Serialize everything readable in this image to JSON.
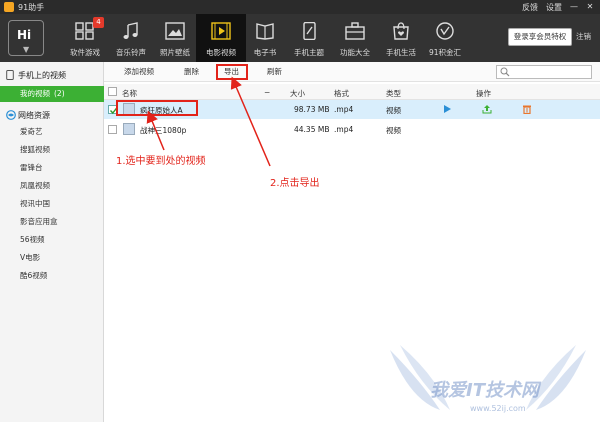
{
  "app": {
    "title": "91助手"
  },
  "titlebar": {
    "links": [
      "反馈",
      "设置"
    ],
    "minimize": "—",
    "close": "✕"
  },
  "topnav": {
    "hi_label": "Hi",
    "hi_arrow": "▼",
    "items": [
      {
        "label": "软件游戏",
        "icon": "apps-grid-icon",
        "badge": "4"
      },
      {
        "label": "音乐铃声",
        "icon": "music-note-icon"
      },
      {
        "label": "照片壁纸",
        "icon": "photo-icon"
      },
      {
        "label": "电影视频",
        "icon": "film-icon",
        "active": true
      },
      {
        "label": "电子书",
        "icon": "book-icon"
      },
      {
        "label": "手机主题",
        "icon": "phone-theme-icon"
      },
      {
        "label": "功能大全",
        "icon": "toolbox-icon"
      },
      {
        "label": "手机生活",
        "icon": "shopping-bag-icon"
      },
      {
        "label": "91积金汇",
        "icon": "coin-icon"
      }
    ],
    "vip_button": "登录享会员特权",
    "logout": "注销"
  },
  "sidebar": {
    "phone_section": "手机上的视频",
    "my_video": {
      "label": "我的视频",
      "count": "(2)"
    },
    "net_section": "网络资源",
    "net_items": [
      "爱奇艺",
      "搜狐视频",
      "雷锋台",
      "凤凰视频",
      "视讯中国",
      "影音应用盒",
      "56视频",
      "V电影",
      "酷6视频"
    ]
  },
  "toolbar": {
    "add": "添加视频",
    "delete": "删除",
    "export": "导出",
    "refresh": "刷新",
    "search_placeholder": ""
  },
  "table": {
    "headers": {
      "name": "名称",
      "sort": "−",
      "size": "大小",
      "format": "格式",
      "type": "类型",
      "actions": "操作"
    },
    "rows": [
      {
        "name": "疯狂原始人A",
        "size": "98.73 MB",
        "format": ".mp4",
        "type": "视频",
        "checked": true
      },
      {
        "name": "战神三1080p",
        "size": "44.35 MB",
        "format": ".mp4",
        "type": "视频",
        "checked": false
      }
    ]
  },
  "annotations": {
    "step1": "1.选中要到处的视频",
    "step2": "2.点击导出"
  },
  "watermark": {
    "text": "我爱IT技术网",
    "url": "www.52ij.com"
  },
  "colors": {
    "accent_green": "#3cb034",
    "annotation_red": "#e2231a",
    "nav_bg": "#333333",
    "selected_row": "#d9eefc"
  }
}
